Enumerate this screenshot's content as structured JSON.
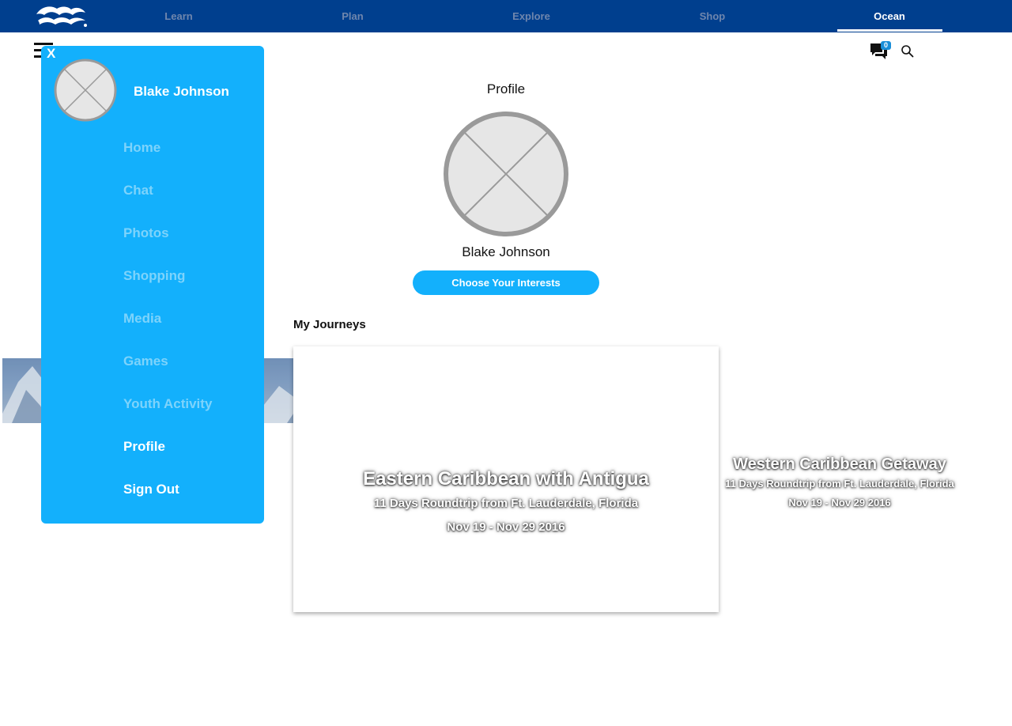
{
  "nav": {
    "items": [
      {
        "label": "Learn",
        "active": false
      },
      {
        "label": "Plan",
        "active": false
      },
      {
        "label": "Explore",
        "active": false
      },
      {
        "label": "Shop",
        "active": false
      },
      {
        "label": "Ocean",
        "active": true
      }
    ]
  },
  "header": {
    "chat_count": "0",
    "icons": [
      "menu-icon",
      "chat-icon",
      "search-icon"
    ]
  },
  "drawer": {
    "close_label": "X",
    "user_name": "Blake Johnson",
    "items": [
      {
        "label": "Home"
      },
      {
        "label": "Chat"
      },
      {
        "label": "Photos"
      },
      {
        "label": "Shopping"
      },
      {
        "label": "Media"
      },
      {
        "label": "Games"
      },
      {
        "label": "Youth Activity"
      },
      {
        "label": "Profile"
      },
      {
        "label": "Sign Out"
      }
    ]
  },
  "profile": {
    "title": "Profile",
    "name": "Blake Johnson",
    "interests_button": "Choose Your Interests"
  },
  "journeys": {
    "title": "My Journeys",
    "cards": [
      {
        "title": "Eastern Caribbean with Antigua",
        "subtitle": "11 Days Roundtrip from Ft. Lauderdale, Florida",
        "dates": "Nov 19 - Nov 29 2016"
      },
      {
        "title": "Western Caribbean Getaway",
        "subtitle": "11 Days Roundtrip from Ft. Lauderdale, Florida",
        "dates": "Nov 19 - Nov 29 2016"
      }
    ]
  },
  "colors": {
    "nav_background": "#003f8e",
    "accent_blue": "#13b0fc",
    "inactive_nav_text": "#6f86ad",
    "inactive_drawer_text": "#7dd3fb"
  }
}
